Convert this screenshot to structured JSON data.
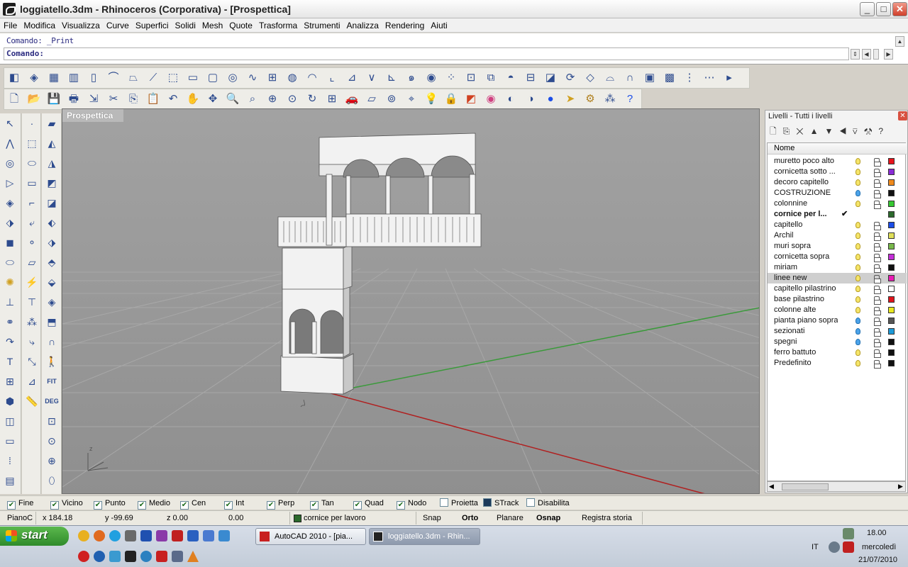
{
  "window": {
    "title": "loggiatello.3dm - Rhinoceros (Corporativa) - [Prospettica]",
    "minimize": "_",
    "maximize": "□",
    "close": "✕"
  },
  "menu": [
    "File",
    "Modifica",
    "Visualizza",
    "Curve",
    "Superfici",
    "Solidi",
    "Mesh",
    "Quote",
    "Trasforma",
    "Strumenti",
    "Analizza",
    "Rendering",
    "Aiuti"
  ],
  "command": {
    "history": "Comando: _Print",
    "prompt": "Comando:",
    "value": ""
  },
  "viewport": {
    "title": "Prospettica",
    "axis_label": "z"
  },
  "layers_panel": {
    "title": "Livelli - Tutti i livelli",
    "close": "✕",
    "column_name": "Nome",
    "tools": [
      "new-layer",
      "new-sublayer",
      "delete",
      "move-up",
      "move-down",
      "move-left",
      "filter",
      "tools",
      "help"
    ],
    "help": "?",
    "layers": [
      {
        "name": "muretto poco alto",
        "color": "#e8141c",
        "bulb": "yellow",
        "current": false,
        "selected": false
      },
      {
        "name": "cornicetta sotto ...",
        "color": "#8a2bd6",
        "bulb": "yellow",
        "current": false,
        "selected": false
      },
      {
        "name": "decoro capitello",
        "color": "#f08a1c",
        "bulb": "yellow",
        "current": false,
        "selected": false
      },
      {
        "name": "COSTRUZIONE",
        "color": "#111111",
        "bulb": "blue",
        "current": false,
        "selected": false
      },
      {
        "name": "colonnine",
        "color": "#36c832",
        "bulb": "yellow",
        "current": false,
        "selected": false
      },
      {
        "name": "cornice per l...",
        "color": "#2c6a2c",
        "bulb": "none",
        "current": true,
        "selected": false,
        "check": "✔"
      },
      {
        "name": "capitello",
        "color": "#1c4ee8",
        "bulb": "yellow",
        "current": false,
        "selected": false
      },
      {
        "name": "Archil",
        "color": "#e0e05a",
        "bulb": "yellow",
        "current": false,
        "selected": false
      },
      {
        "name": "muri sopra",
        "color": "#78b84a",
        "bulb": "yellow",
        "current": false,
        "selected": false
      },
      {
        "name": "cornicetta sopra",
        "color": "#c42ed8",
        "bulb": "yellow",
        "current": false,
        "selected": false
      },
      {
        "name": "miriam",
        "color": "#111111",
        "bulb": "yellow",
        "current": false,
        "selected": false
      },
      {
        "name": "linee new",
        "color": "#e81cb4",
        "bulb": "yellow",
        "current": false,
        "selected": true
      },
      {
        "name": "capitello pilastrino",
        "color": "#ffffff",
        "bulb": "yellow",
        "current": false,
        "selected": false
      },
      {
        "name": "base pilastrino",
        "color": "#e0141c",
        "bulb": "yellow",
        "current": false,
        "selected": false
      },
      {
        "name": "colonne alte",
        "color": "#e8e820",
        "bulb": "yellow",
        "current": false,
        "selected": false
      },
      {
        "name": "pianta piano sopra",
        "color": "#555555",
        "bulb": "blue",
        "current": false,
        "selected": false
      },
      {
        "name": "sezionati",
        "color": "#1c9ad8",
        "bulb": "blue",
        "current": false,
        "selected": false
      },
      {
        "name": "spegni",
        "color": "#111111",
        "bulb": "blue",
        "current": false,
        "selected": false
      },
      {
        "name": "ferro battuto",
        "color": "#111111",
        "bulb": "yellow",
        "current": false,
        "selected": false
      },
      {
        "name": "Predefinito",
        "color": "#111111",
        "bulb": "yellow",
        "current": false,
        "selected": false
      }
    ]
  },
  "osnap": [
    {
      "label": "Fine",
      "checked": true
    },
    {
      "label": "Vicino",
      "checked": true
    },
    {
      "label": "Punto",
      "checked": true
    },
    {
      "label": "Medio",
      "checked": true
    },
    {
      "label": "Cen",
      "checked": true
    },
    {
      "label": "Int",
      "checked": true
    },
    {
      "label": "Perp",
      "checked": true
    },
    {
      "label": "Tan",
      "checked": true
    },
    {
      "label": "Quad",
      "checked": true
    },
    {
      "label": "Nodo",
      "checked": true
    },
    {
      "label": "Proietta",
      "checked": false
    },
    {
      "label": "STrack",
      "checked": true
    },
    {
      "label": "Disabilita",
      "checked": false
    }
  ],
  "status": {
    "cplane": "PianoC",
    "x": "x 184.18",
    "y": "y -99.69",
    "z": "z 0.00",
    "dist": "0.00",
    "layer": "cornice per lavoro",
    "layer_color": "#2c6a2c",
    "snap": "Snap",
    "orto": "Orto",
    "planare": "Planare",
    "osnap": "Osnap",
    "history": "Registra storia"
  },
  "taskbar": {
    "start": "start",
    "tasks": [
      {
        "label": "AutoCAD 2010 - [pia...",
        "active": false
      },
      {
        "label": "loggiatello.3dm - Rhin...",
        "active": true
      }
    ],
    "lang": "IT",
    "time": "18.00",
    "day": "mercoledì",
    "date": "21/07/2010"
  },
  "icons": {
    "top_toolbar_1": [
      "layer-icon",
      "material-icon",
      "grid-icon",
      "mesh-icon",
      "cylinder-icon",
      "sweep-icon",
      "loft-icon",
      "twist-icon",
      "box-edit-icon",
      "rect-icon",
      "rect2-icon",
      "circle-icon",
      "curve-icon",
      "cage-icon",
      "sphere-icon",
      "arc-icon",
      "fillet-icon",
      "chamfer-icon",
      "join-icon",
      "trim-icon",
      "spiral-icon",
      "point-icon",
      "select-icon",
      "layout-icon",
      "flow-icon",
      "dome-icon",
      "patch-icon",
      "split-icon",
      "rotate-icon",
      "revolve-icon",
      "bell-icon",
      "arch-icon",
      "render-icon",
      "grid2-icon"
    ],
    "top_toolbar_2": [
      "new-icon",
      "open-icon",
      "save-icon",
      "print-icon",
      "import-icon",
      "cut-icon",
      "copy-icon",
      "paste-icon",
      "undo-icon",
      "pan-icon",
      "move-icon",
      "zoom-icon",
      "zoom-window-icon",
      "zoom-extents-icon",
      "zoom-selected-icon",
      "rotate-view-icon",
      "four-view-icon",
      "car-icon",
      "plane-icon",
      "target-icon",
      "snap-icon",
      "light-icon",
      "lock-icon",
      "paint-icon",
      "color-wheel-icon",
      "wireframe-icon",
      "shaded-icon",
      "render-sphere-icon",
      "pointer-icon",
      "settings-icon",
      "options-icon",
      "help-icon"
    ]
  }
}
